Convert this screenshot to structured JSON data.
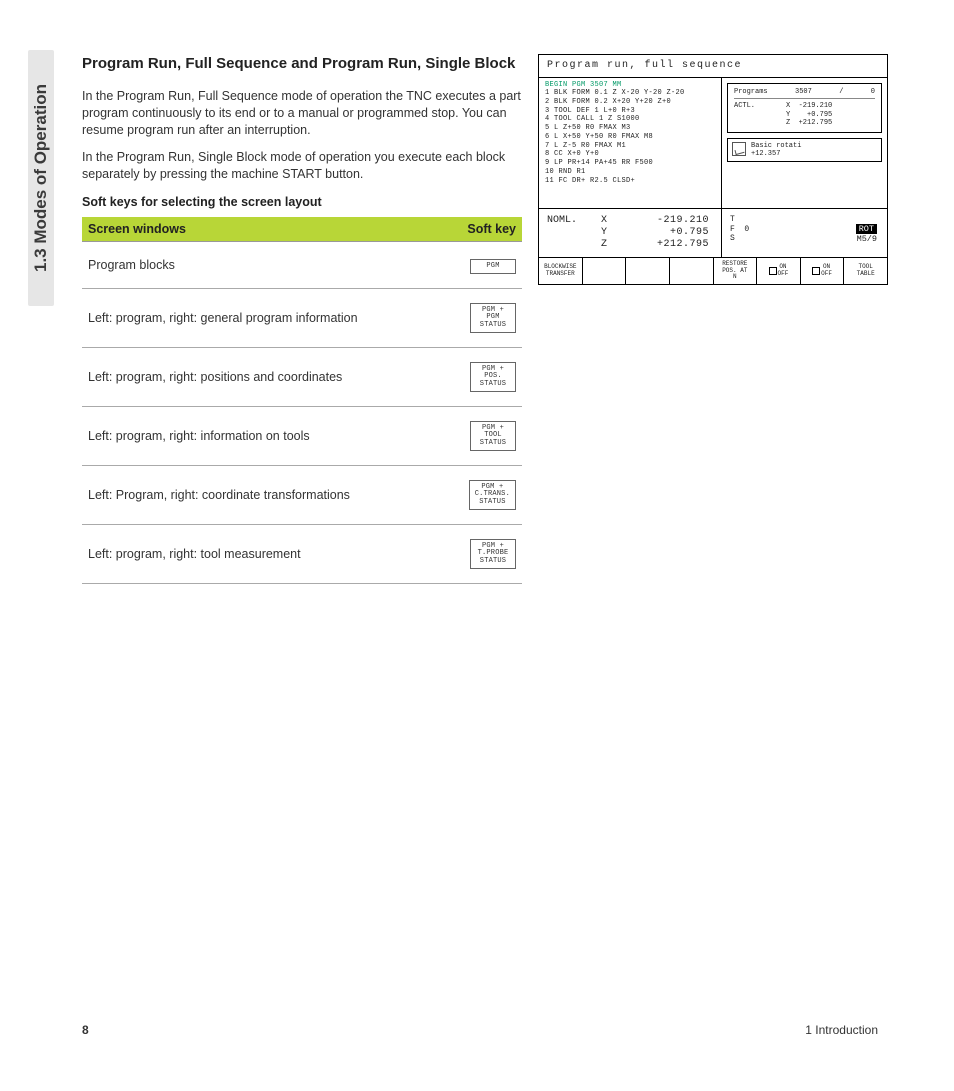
{
  "side_tab": "1.3 Modes of Operation",
  "heading": "Program Run, Full Sequence and Program Run, Single Block",
  "para1": "In the Program Run, Full Sequence mode of operation the TNC executes a part program continuously to its end or to a manual or programmed stop. You can resume program run after an interruption.",
  "para2": "In the Program Run, Single Block mode of operation you execute each block separately by pressing the machine START button.",
  "subhead": "Soft keys for selecting the screen layout",
  "table": {
    "col1": "Screen windows",
    "col2": "Soft key",
    "rows": [
      {
        "desc": "Program blocks",
        "key": "PGM"
      },
      {
        "desc": "Left: program, right: general program information",
        "key": "PGM +\nPGM\nSTATUS"
      },
      {
        "desc": "Left: program, right: positions and coordinates",
        "key": "PGM +\nPOS.\nSTATUS"
      },
      {
        "desc": "Left: program, right: information on tools",
        "key": "PGM +\nTOOL\nSTATUS"
      },
      {
        "desc": "Left: Program, right: coordinate transformations",
        "key": "PGM +\nC.TRANS.\nSTATUS"
      },
      {
        "desc": "Left: program, right: tool measurement",
        "key": "PGM +\nT.PROBE\nSTATUS"
      }
    ]
  },
  "cnc": {
    "title": "Program run, full sequence",
    "begin": "BEGIN PGM 3507 MM",
    "lines": [
      "1  BLK FORM 0.1 Z  X-20  Y-20  Z-20",
      "2  BLK FORM 0.2  X+20  Y+20  Z+0",
      "3  TOOL DEF 1 L+0 R+3",
      "4  TOOL CALL 1 Z S1000",
      "5  L  Z+50 R0 FMAX M3",
      "6  L  X+50  Y+50 R0 FMAX M8",
      "7  L  Z-5 R0 FMAX M1",
      "8  CC  X+0  Y+0",
      "9  LP  PR+14  PA+45 RR F500",
      "10 RND R1",
      "11 FC DR+ R2.5 CLSD+"
    ],
    "programs_label": "Programs",
    "programs_value": "3507",
    "programs_slash": "/",
    "programs_zero": "0",
    "actl_label": "ACTL.",
    "actl_x": "-219.210",
    "actl_y": "+0.795",
    "actl_z": "+212.795",
    "rota_label": "Basic rotati",
    "rota_value": "+12.357",
    "noml_label": "NOML.",
    "noml_x_axis": "X",
    "noml_x": "-219.210",
    "noml_y_axis": "Y",
    "noml_y": "+0.795",
    "noml_z_axis": "Z",
    "noml_z": "+212.795",
    "t": "T",
    "f": "F",
    "f_val": "0",
    "s": "S",
    "rot": "ROT",
    "m59": "M5/9",
    "sk": [
      "BLOCKWISE\nTRANSFER",
      "",
      "",
      "",
      "RESTORE\nPOS. AT\nN",
      "ON\nOFF",
      "ON\nOFF",
      "TOOL\nTABLE"
    ]
  },
  "footer": {
    "page": "8",
    "chapter": "1 Introduction"
  }
}
